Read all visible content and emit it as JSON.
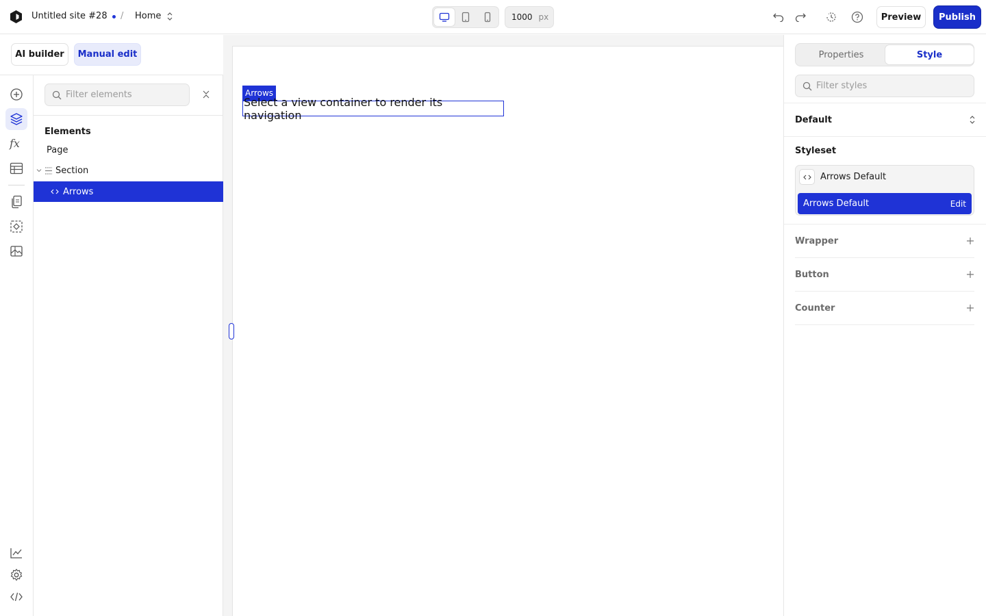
{
  "app": {
    "site_title": "Untitled site #28",
    "separator": "/",
    "current_page": "Home"
  },
  "toolbar": {
    "width_value": "1000",
    "width_unit": "px",
    "devices": [
      "desktop",
      "tablet",
      "mobile"
    ],
    "active_device": "desktop",
    "preview_label": "Preview",
    "publish_label": "Publish"
  },
  "rail": {
    "items": [
      "add-icon",
      "layers-icon",
      "function-icon",
      "table-icon",
      "pages-icon",
      "components-icon",
      "assets-icon",
      "analytics-icon",
      "settings-icon",
      "code-icon"
    ],
    "active": "layers-icon"
  },
  "left_panel": {
    "mode_ai": "AI builder",
    "mode_manual": "Manual edit",
    "filter_placeholder": "Filter elements",
    "elements_heading": "Elements",
    "tree": [
      {
        "label": "Page"
      },
      {
        "label": "Section"
      },
      {
        "label": "Arrows"
      }
    ]
  },
  "canvas": {
    "selected_tag": "Arrows",
    "selected_text": "Select a view container to render its navigation"
  },
  "right_panel": {
    "tabs": [
      "Properties",
      "Style"
    ],
    "active_tab": "Style",
    "filter_placeholder": "Filter styles",
    "state_label": "Default",
    "styleset_heading": "Styleset",
    "styleset_name": "Arrows Default",
    "styleset_item": "Arrows Default",
    "edit_label": "Edit",
    "parts": [
      "Wrapper",
      "Button",
      "Counter"
    ]
  },
  "colors": {
    "accent": "#1f33d6",
    "accent_soft": "#e8ebfb",
    "publish": "#1a2fc9"
  }
}
